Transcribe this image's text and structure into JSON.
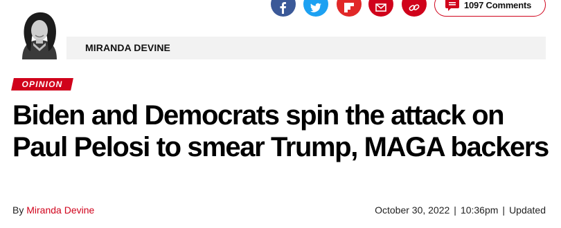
{
  "share": {
    "buttons": [
      {
        "icon": "facebook-icon",
        "color": "#3b5998"
      },
      {
        "icon": "twitter-icon",
        "color": "#1da1f2"
      },
      {
        "icon": "flipboard-icon",
        "color": "#e12828"
      },
      {
        "icon": "email-icon",
        "color": "#d0021b"
      },
      {
        "icon": "link-icon",
        "color": "#d0021b"
      }
    ],
    "comments_label": "1097 Comments"
  },
  "author": {
    "name": "MIRANDA DEVINE"
  },
  "article": {
    "section_tag": "OPINION",
    "headline": "Biden and Democrats spin the attack on Paul Pelosi to smear Trump, MAGA backers",
    "byline_prefix": "By",
    "byline_author": "Miranda Devine",
    "date": "October 30, 2022",
    "time": "10:36pm",
    "updated_label": "Updated",
    "separator": "|"
  },
  "colors": {
    "accent": "#d0021b",
    "author_bar_bg": "#f2f2f2"
  }
}
